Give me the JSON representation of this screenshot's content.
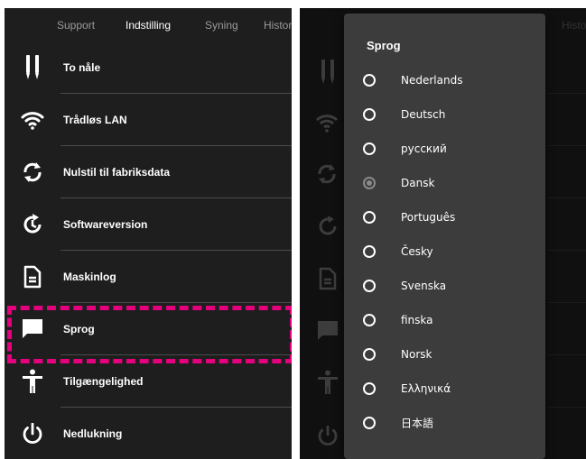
{
  "left": {
    "tabs": [
      {
        "label": "Support",
        "active": false
      },
      {
        "label": "Indstilling",
        "active": true
      },
      {
        "label": "Syning",
        "active": false
      },
      {
        "label": "Historik",
        "active": false
      }
    ],
    "settings": [
      {
        "label": "To nåle",
        "icon": "twin-needle-icon"
      },
      {
        "label": "Trådløs LAN",
        "icon": "wifi-icon"
      },
      {
        "label": "Nulstil til fabriksdata",
        "icon": "reset-icon"
      },
      {
        "label": "Softwareversion",
        "icon": "software-update-icon"
      },
      {
        "label": "Maskinlog",
        "icon": "document-icon"
      },
      {
        "label": "Sprog",
        "icon": "chat-bubble-icon"
      },
      {
        "label": "Tilgængelighed",
        "icon": "accessibility-icon"
      },
      {
        "label": "Nedlukning",
        "icon": "power-icon"
      }
    ],
    "highlighted_item": "Sprog"
  },
  "right": {
    "background_tab": "Historik",
    "dialog": {
      "title": "Sprog",
      "options": [
        {
          "label": "Nederlands",
          "selected": false
        },
        {
          "label": "Deutsch",
          "selected": false
        },
        {
          "label": "русский",
          "selected": false
        },
        {
          "label": "Dansk",
          "selected": true
        },
        {
          "label": "Português",
          "selected": false
        },
        {
          "label": "Česky",
          "selected": false
        },
        {
          "label": "Svenska",
          "selected": false
        },
        {
          "label": "finska",
          "selected": false
        },
        {
          "label": "Norsk",
          "selected": false
        },
        {
          "label": "Ελληνικά",
          "selected": false
        },
        {
          "label": "日本語",
          "selected": false
        }
      ]
    }
  },
  "colors": {
    "panel_bg": "#1e1e1e",
    "dialog_bg": "#3c3c3c",
    "highlight": "#e5007e",
    "text": "#ffffff",
    "inactive_tab": "#9a9a9a"
  }
}
